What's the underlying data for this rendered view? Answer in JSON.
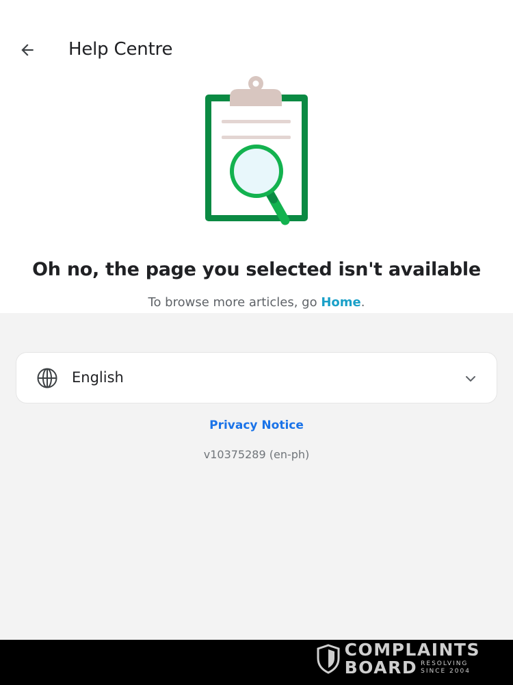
{
  "header": {
    "title": "Help Centre",
    "back_icon": "arrow-left-icon"
  },
  "illustration": {
    "name": "clipboard-magnifier-illustration",
    "colors": {
      "frame": "#0b8a43",
      "clip": "#d8c6c0",
      "lines": "#e3d5d2",
      "lens_ring": "#13b24f",
      "lens_fill": "#e8f7fb"
    }
  },
  "error": {
    "title": "Oh no, the page you selected isn't available",
    "subtitle_prefix": "To browse more articles, go ",
    "home_link": "Home",
    "subtitle_suffix": "."
  },
  "language": {
    "selected": "English",
    "icon": "globe-icon",
    "dropdown_icon": "chevron-down-icon"
  },
  "footer": {
    "privacy_link": "Privacy Notice",
    "version": "v10375289 (en-ph)"
  },
  "watermark": {
    "line1": "COMPLAINTS",
    "line2": "BOARD",
    "tag1": "RESOLVING",
    "tag2": "SINCE 2004"
  },
  "colors": {
    "link": "#1a73e8",
    "home_link": "#1aa0c8",
    "background_gray": "#f3f3f3"
  }
}
